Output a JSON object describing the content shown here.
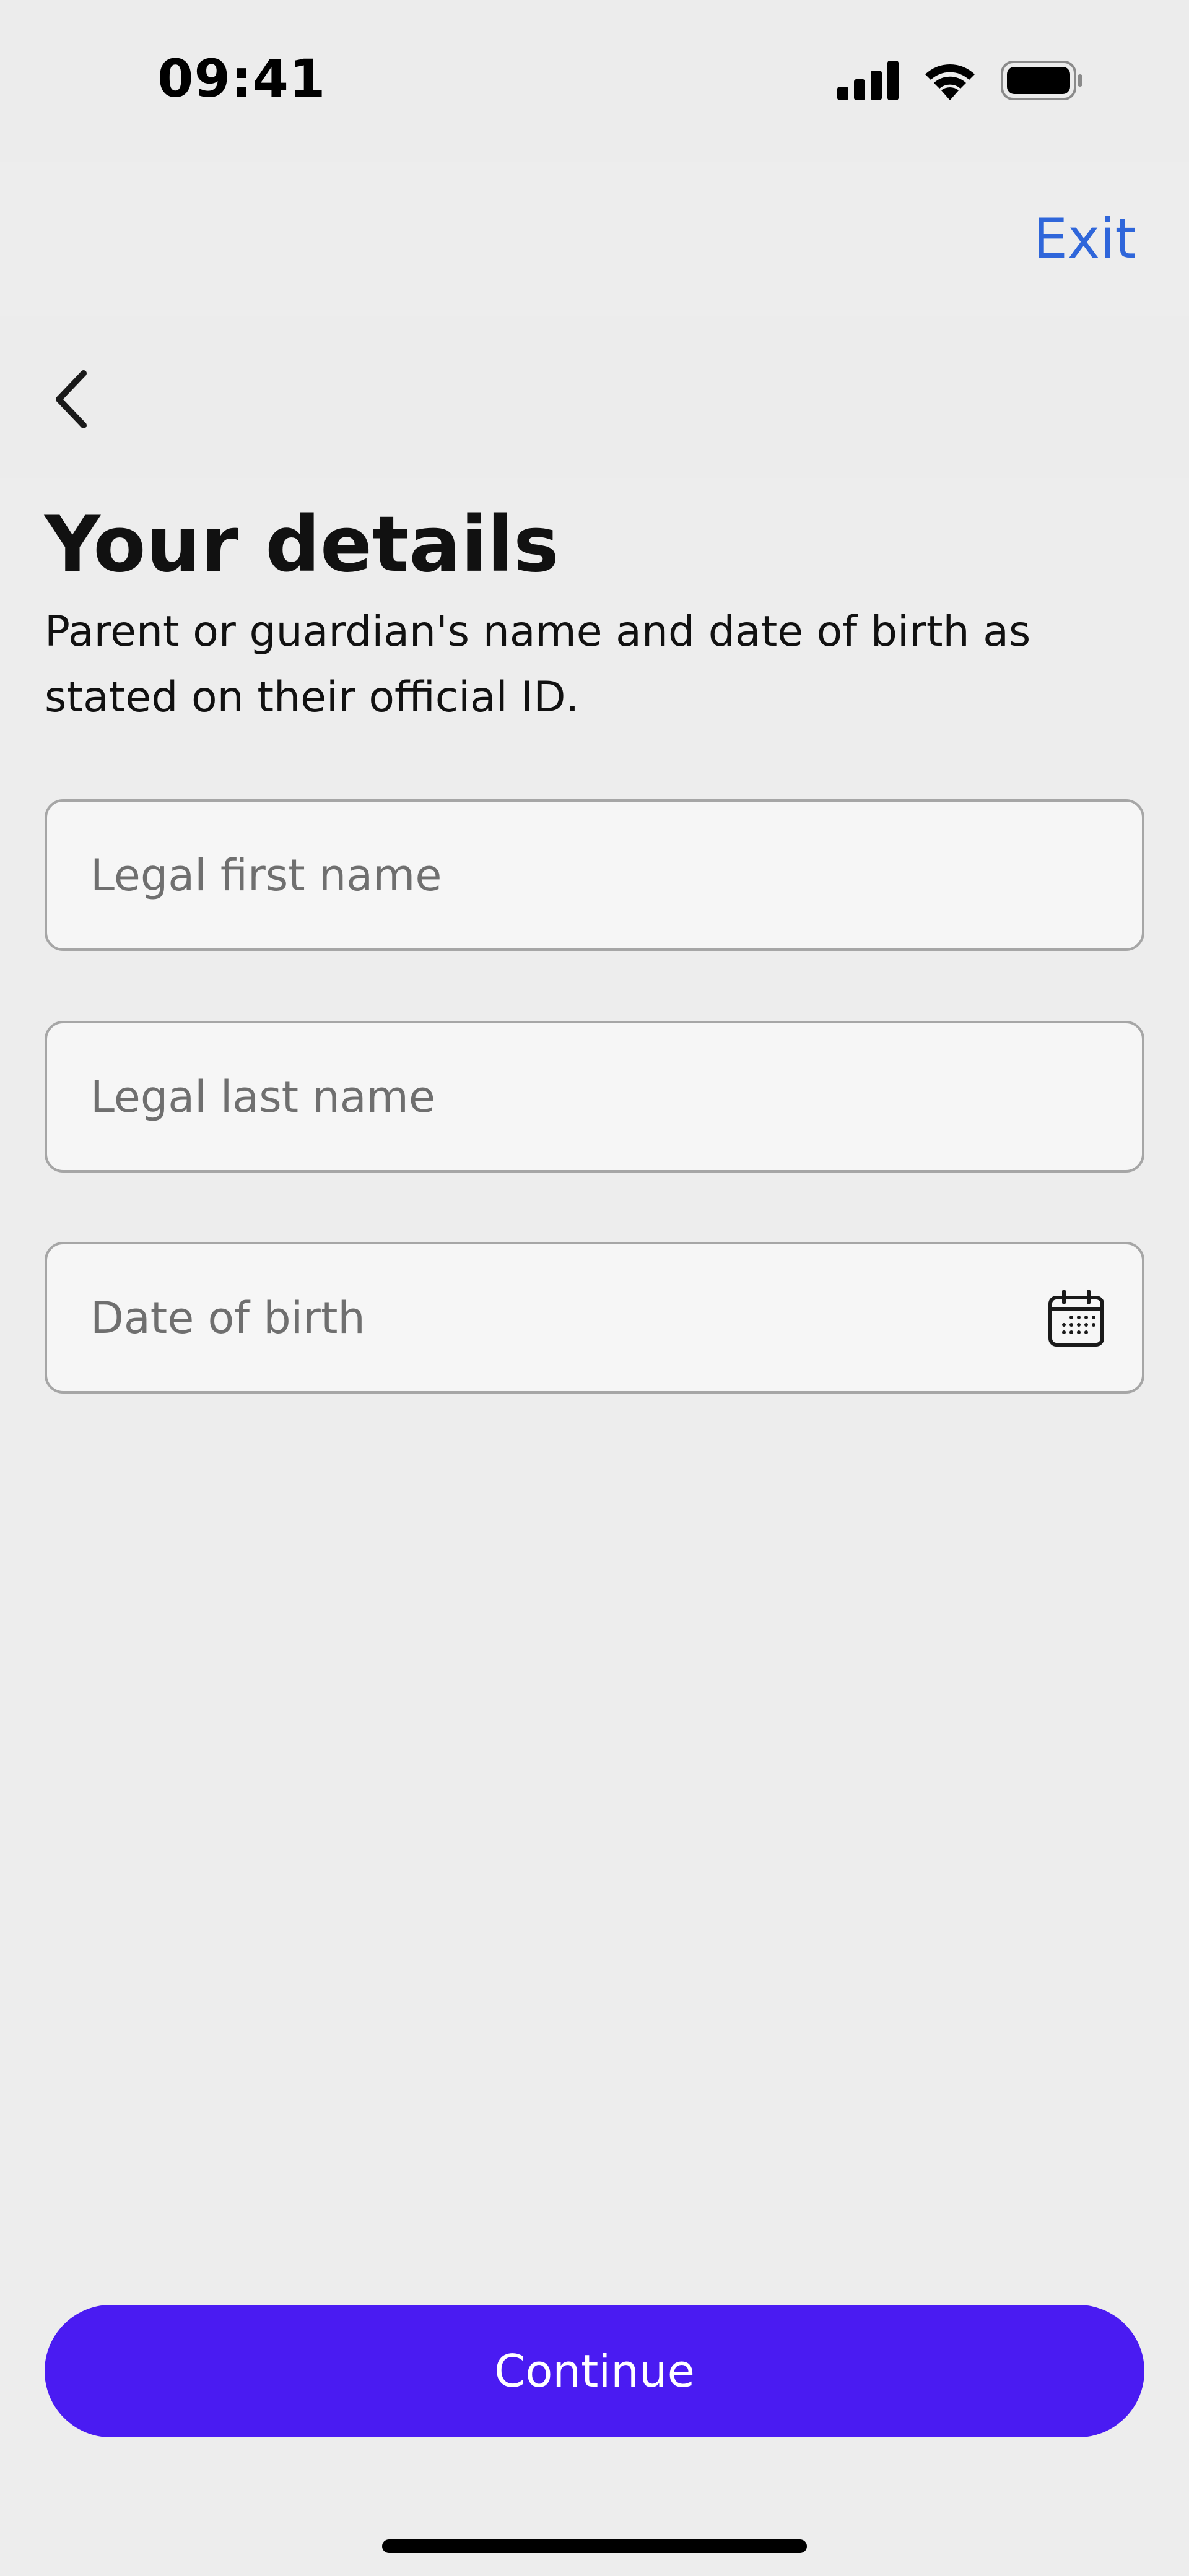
{
  "status_bar": {
    "time": "09:41",
    "icons": [
      "cellular-signal-icon",
      "wifi-icon",
      "battery-icon"
    ]
  },
  "header": {
    "exit_label": "Exit",
    "back_icon": "chevron-left-icon"
  },
  "page": {
    "title": "Your details",
    "subtitle": "Parent or guardian's name and date of birth as stated on their official ID."
  },
  "form": {
    "first_name": {
      "placeholder": "Legal first name",
      "value": ""
    },
    "last_name": {
      "placeholder": "Legal last name",
      "value": ""
    },
    "date_of_birth": {
      "placeholder": "Date of birth",
      "value": "",
      "icon": "calendar-icon"
    }
  },
  "footer": {
    "continue_label": "Continue"
  },
  "colors": {
    "accent": "#4a1bf2",
    "link": "#2f66da",
    "background": "#ededed",
    "field_background": "#f6f6f6",
    "field_border": "#a6a6a6"
  }
}
